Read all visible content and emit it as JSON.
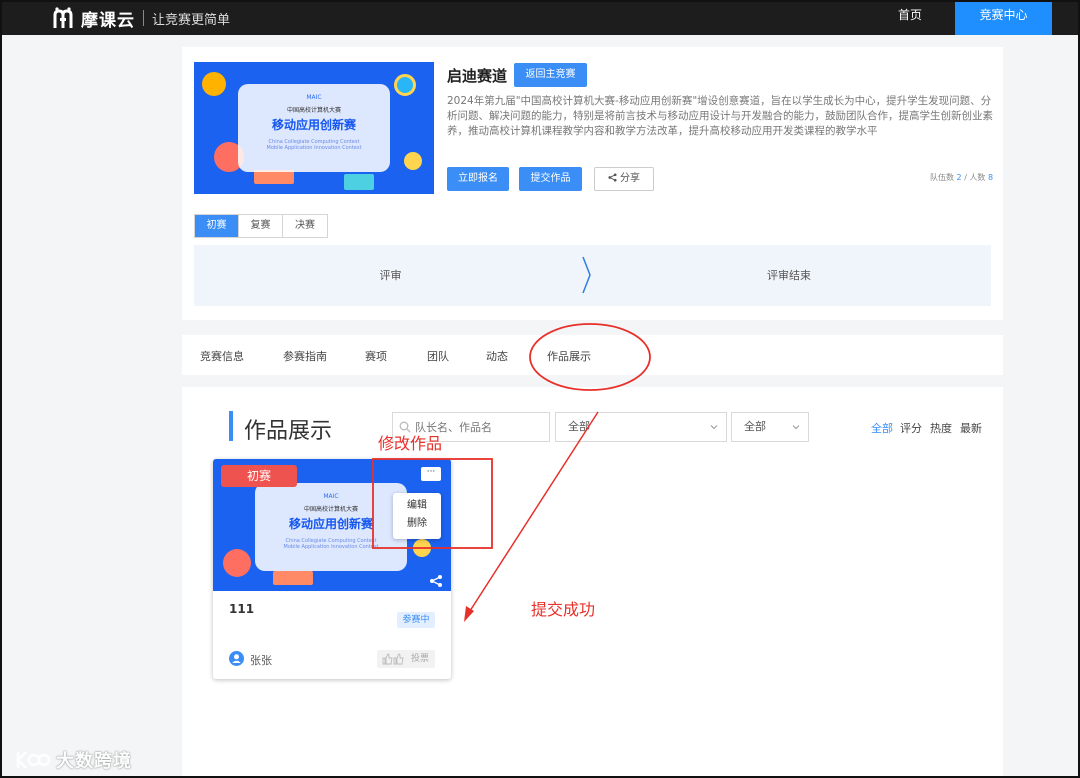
{
  "topnav": {
    "brand": "摩课云",
    "slogan": "让竞赛更简单",
    "home": "首页",
    "center": "竞赛中心"
  },
  "hero": {
    "title": "启迪赛道",
    "return_button": "返回主竞赛",
    "description": "2024年第九届\"中国高校计算机大赛-移动应用创新赛\"增设创意赛道，旨在以学生成长为中心，提升学生发现问题、分析问题、解决问题的能力，特别是将前言技术与移动应用设计与开发融合的能力，鼓励团队合作，提高学生创新创业素养，推动高校计算机课程教学内容和教学方法改革，提升高校移动应用开发类课程的教学水平",
    "register_button": "立即报名",
    "submit_button": "提交作品",
    "share_button": "分享",
    "team_label": "队伍数",
    "team_count": "2",
    "people_label": "/ 人数",
    "people_count": "8",
    "banner": {
      "line1": "中国高校计算机大赛",
      "line2": "移动应用创新赛",
      "line3": "China Collegiate Computing Contest",
      "line4": "Mobile Application Innovation Contest"
    }
  },
  "stage_tabs": [
    "初赛",
    "复赛",
    "决赛"
  ],
  "timeline": {
    "left": "评审",
    "right": "评审结束"
  },
  "section_tabs": [
    "竞赛信息",
    "参赛指南",
    "赛项",
    "团队",
    "动态",
    "作品展示"
  ],
  "gallery": {
    "title": "作品展示",
    "search_placeholder": "队长名、作品名",
    "select1": "全部",
    "select2": "全部",
    "sort_options": [
      "全部",
      "评分",
      "热度",
      "最新"
    ]
  },
  "card": {
    "badge": "初赛",
    "more": "···",
    "menu_edit": "编辑",
    "menu_delete": "删除",
    "name": "111",
    "status": "参赛中",
    "author": "张张",
    "vote": "投票"
  },
  "annotations": {
    "edit_work": "修改作品",
    "submit_success": "提交成功"
  },
  "watermark": "大数跨境",
  "colors": {
    "accent": "#3a8ef6",
    "nav_bg": "#1d1d1d",
    "nav_active": "#1f8fff",
    "badge_red": "#ef5350",
    "annotation_red": "#e8302a"
  }
}
